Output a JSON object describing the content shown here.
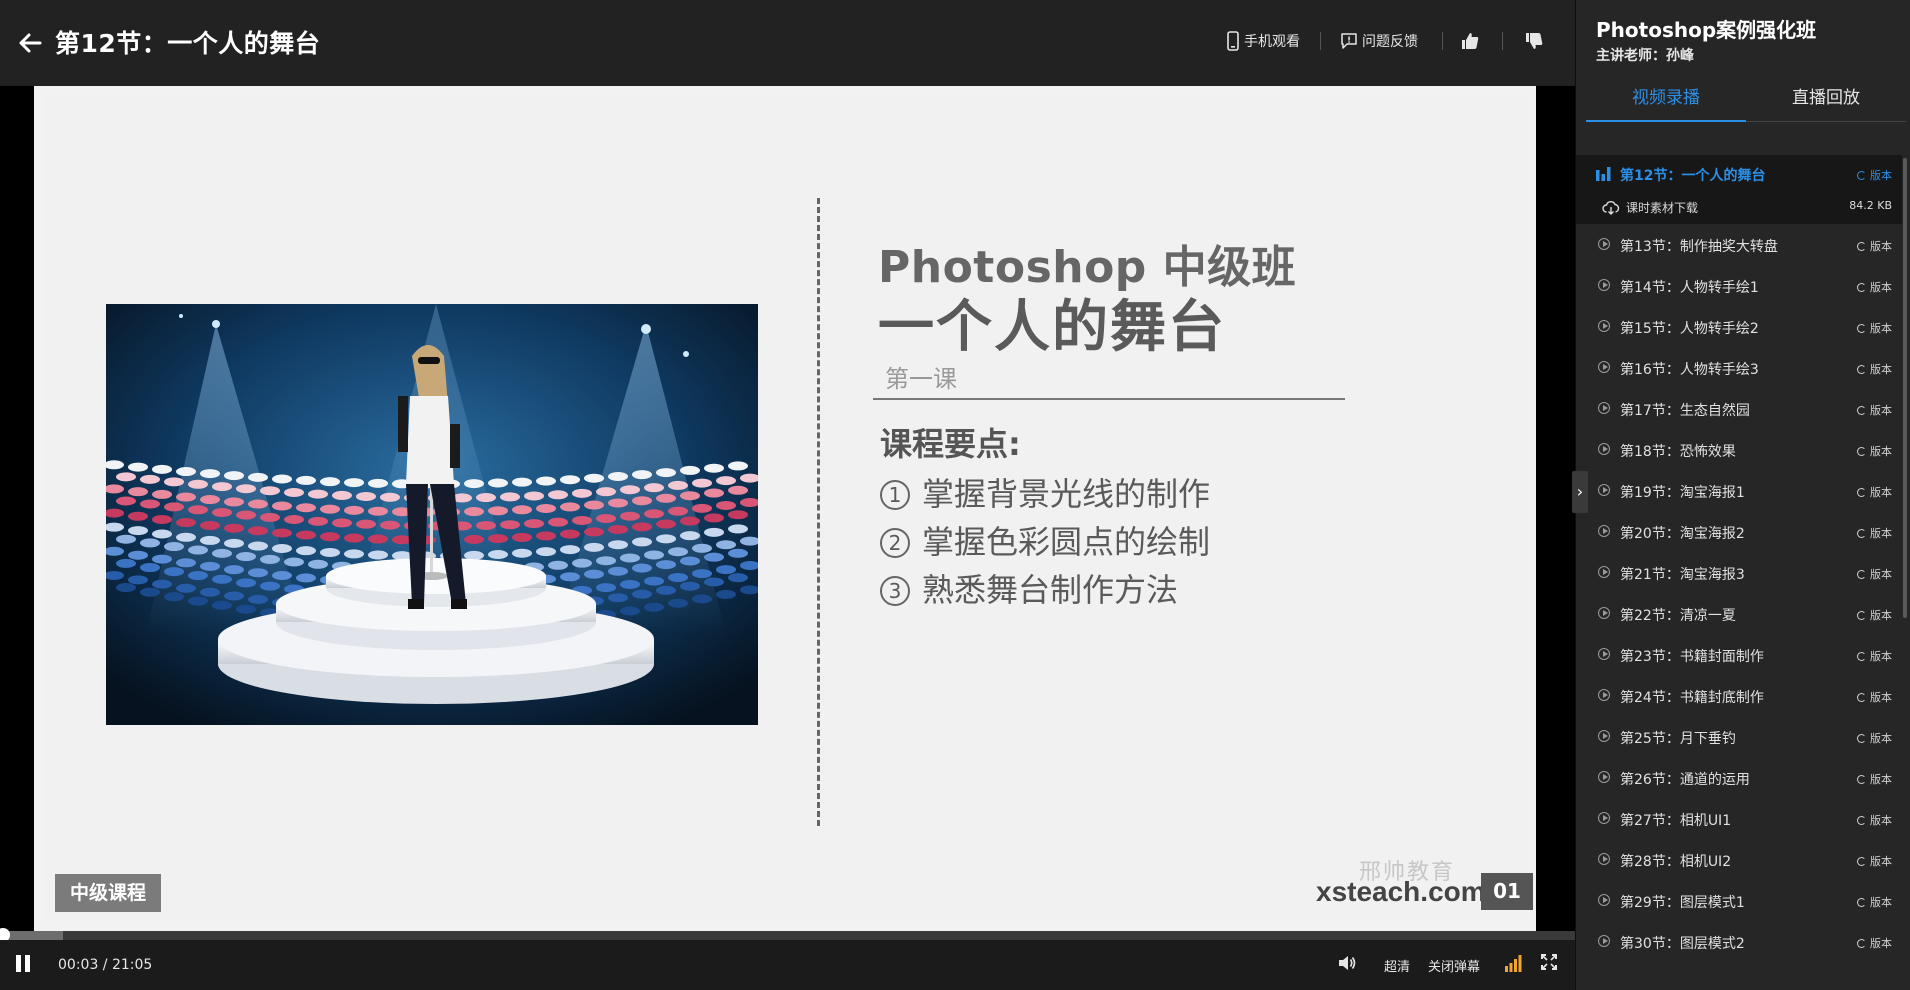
{
  "header": {
    "title": "第12节：一个人的舞台",
    "mobile_watch": "手机观看",
    "feedback": "问题反馈"
  },
  "slide": {
    "title_line1": "Photoshop 中级班",
    "title_line2": "一个人的舞台",
    "subtitle": "第一课",
    "points_title": "课程要点:",
    "points": [
      {
        "num": "1",
        "text": "掌握背景光线的制作"
      },
      {
        "num": "2",
        "text": "掌握色彩圆点的绘制"
      },
      {
        "num": "3",
        "text": "熟悉舞台制作方法"
      }
    ],
    "level_badge": "中级课程",
    "brand": "xsteach.com",
    "watermark": "邢帅教育",
    "slide_number": "01"
  },
  "controls": {
    "current_time": "00:03",
    "separator": " / ",
    "total_time": "21:05",
    "quality": "超清",
    "danmaku": "关闭弹幕",
    "progress_played": 0.002,
    "progress_buffered": 0.04
  },
  "sidebar": {
    "course_title": "Photoshop案例强化班",
    "teacher": "主讲老师：孙峰",
    "tabs": [
      "视频录播",
      "直播回放"
    ],
    "active_chapter": {
      "title": "第12节：一个人的舞台",
      "version": "版本",
      "material": "课时素材下载",
      "material_size": "84.2 KB"
    },
    "chapters": [
      {
        "title": "第13节：制作抽奖大转盘",
        "version": "版本"
      },
      {
        "title": "第14节：人物转手绘1",
        "version": "版本"
      },
      {
        "title": "第15节：人物转手绘2",
        "version": "版本"
      },
      {
        "title": "第16节：人物转手绘3",
        "version": "版本"
      },
      {
        "title": "第17节：生态自然园",
        "version": "版本"
      },
      {
        "title": "第18节：恐怖效果",
        "version": "版本"
      },
      {
        "title": "第19节：淘宝海报1",
        "version": "版本"
      },
      {
        "title": "第20节：淘宝海报2",
        "version": "版本"
      },
      {
        "title": "第21节：淘宝海报3",
        "version": "版本"
      },
      {
        "title": "第22节：清凉一夏",
        "version": "版本"
      },
      {
        "title": "第23节：书籍封面制作",
        "version": "版本"
      },
      {
        "title": "第24节：书籍封底制作",
        "version": "版本"
      },
      {
        "title": "第25节：月下垂钓",
        "version": "版本"
      },
      {
        "title": "第26节：通道的运用",
        "version": "版本"
      },
      {
        "title": "第27节：相机UI1",
        "version": "版本"
      },
      {
        "title": "第28节：相机UI2",
        "version": "版本"
      },
      {
        "title": "第29节：图层模式1",
        "version": "版本"
      },
      {
        "title": "第30节：图层模式2",
        "version": "版本"
      }
    ]
  },
  "colors": {
    "accent": "#2c8fe6",
    "topbar": "#222222",
    "sidebar": "#262626"
  }
}
